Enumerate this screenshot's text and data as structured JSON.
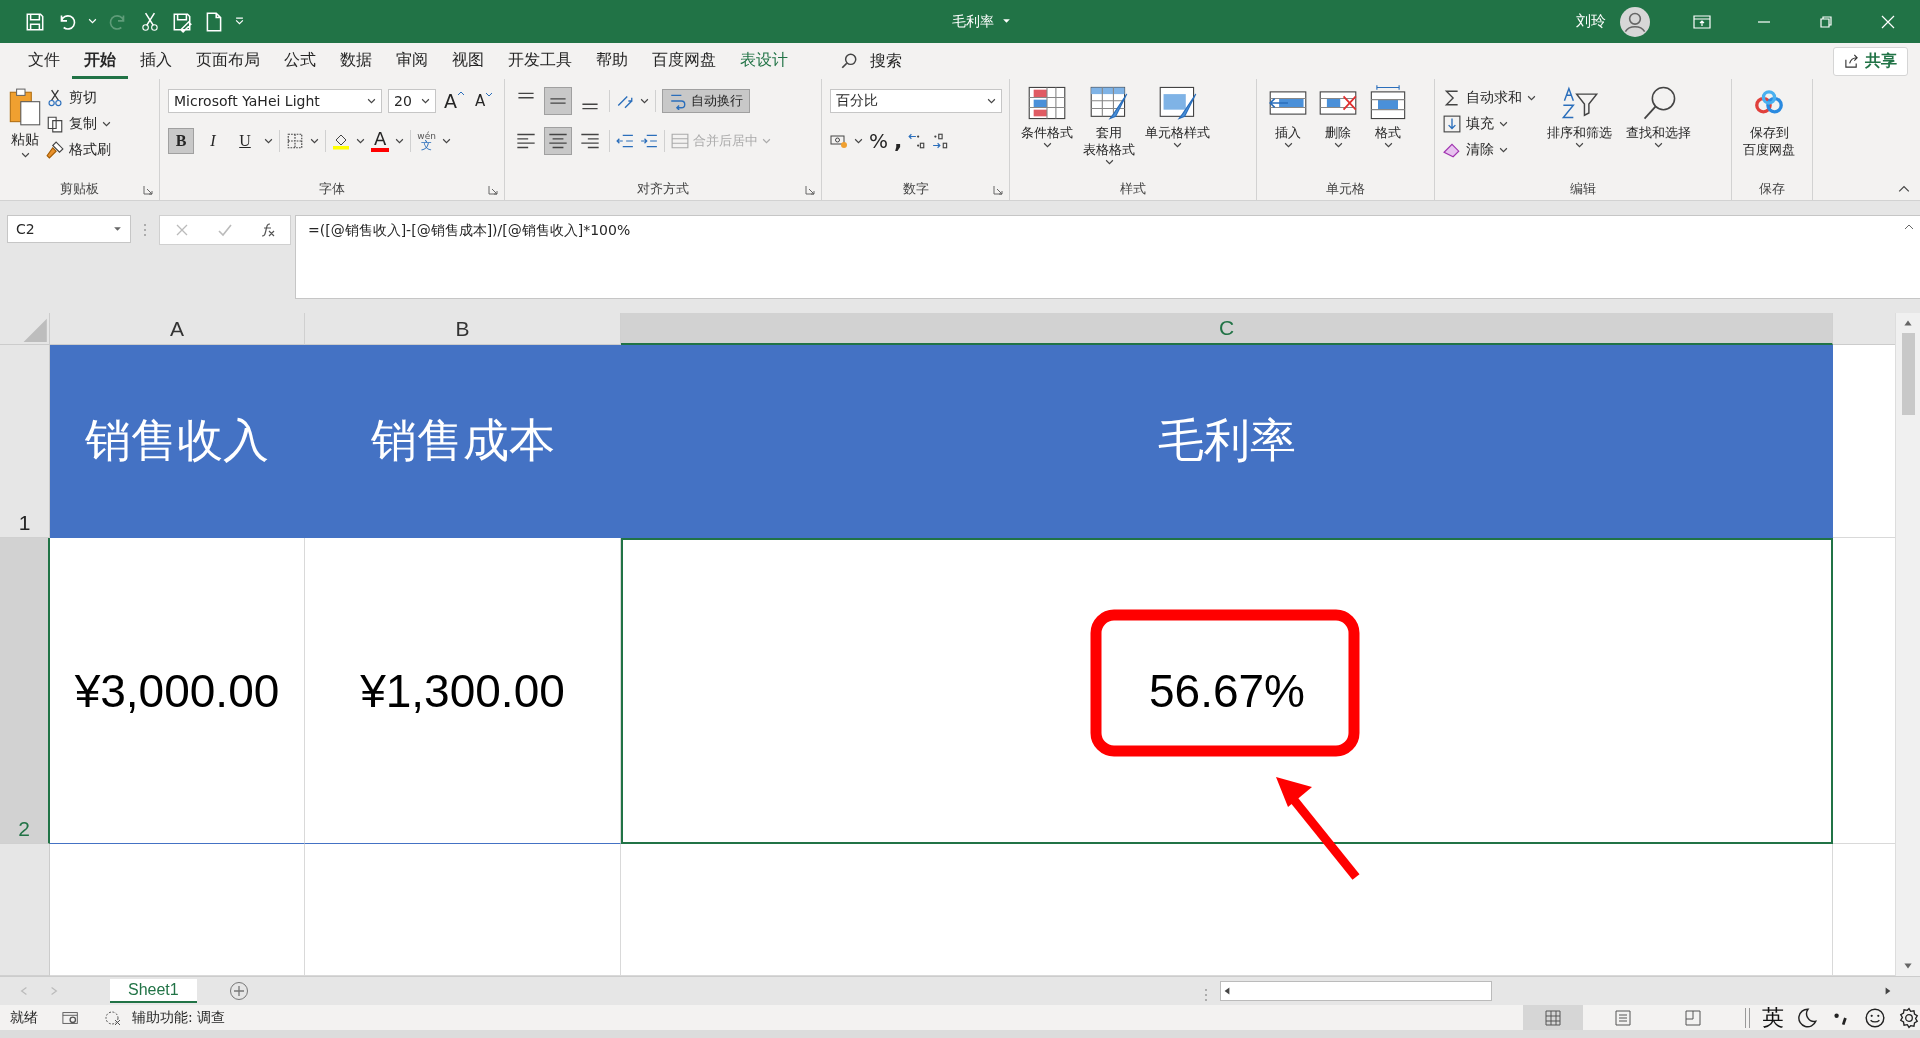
{
  "title_bar": {
    "title": "毛利率",
    "user": "刘玲"
  },
  "menu_tabs": [
    {
      "label": "文件",
      "selected": false,
      "kind": "normal"
    },
    {
      "label": "开始",
      "selected": true,
      "kind": "normal"
    },
    {
      "label": "插入",
      "selected": false,
      "kind": "normal"
    },
    {
      "label": "页面布局",
      "selected": false,
      "kind": "normal"
    },
    {
      "label": "公式",
      "selected": false,
      "kind": "normal"
    },
    {
      "label": "数据",
      "selected": false,
      "kind": "normal"
    },
    {
      "label": "审阅",
      "selected": false,
      "kind": "normal"
    },
    {
      "label": "视图",
      "selected": false,
      "kind": "normal"
    },
    {
      "label": "开发工具",
      "selected": false,
      "kind": "normal"
    },
    {
      "label": "帮助",
      "selected": false,
      "kind": "normal"
    },
    {
      "label": "百度网盘",
      "selected": false,
      "kind": "normal"
    },
    {
      "label": "表设计",
      "selected": false,
      "kind": "contextual"
    }
  ],
  "search": {
    "label": "搜索"
  },
  "share": {
    "label": "共享"
  },
  "ribbon": {
    "groups": [
      {
        "kind": "clipboard",
        "label": "剪贴板",
        "launcher": true,
        "paste": "粘贴",
        "items": [
          "剪切",
          "复制",
          "格式刷"
        ]
      },
      {
        "kind": "font",
        "label": "字体",
        "launcher": true,
        "font_name": "Microsoft YaHei Light",
        "font_size": "20",
        "grow": "A",
        "shrink": "A",
        "styles": [
          {
            "label": "B",
            "on": true
          },
          {
            "label": "I",
            "on": false
          },
          {
            "label": "U",
            "on": false
          }
        ],
        "font_color": "A",
        "phonetic_top": "wén",
        "phonetic_bottom": "文"
      },
      {
        "kind": "alignment",
        "label": "对齐方式",
        "launcher": true,
        "vertical": [
          {
            "selected": false
          },
          {
            "selected": true
          },
          {
            "selected": false
          }
        ],
        "horizontal": [
          {
            "selected": false
          },
          {
            "selected": true
          },
          {
            "selected": false
          }
        ],
        "wrap": {
          "label": "自动换行",
          "on": true
        },
        "merge": {
          "label": "合并后居中",
          "disabled": true
        }
      },
      {
        "kind": "number",
        "label": "数字",
        "launcher": true,
        "format": "百分比",
        "percent": "%",
        "comma": ","
      },
      {
        "kind": "large",
        "label": "样式",
        "items": [
          {
            "lines": [
              "条件格式"
            ],
            "caret": true
          },
          {
            "lines": [
              "套用",
              "表格格式"
            ],
            "caret": true
          },
          {
            "lines": [
              "单元格样式"
            ],
            "caret": true
          }
        ]
      },
      {
        "kind": "large",
        "label": "单元格",
        "items": [
          {
            "lines": [
              "插入"
            ],
            "caret": true
          },
          {
            "lines": [
              "删除"
            ],
            "caret": true
          },
          {
            "lines": [
              "格式"
            ],
            "caret": true
          }
        ]
      },
      {
        "kind": "editing",
        "label": "编辑",
        "small": [
          {
            "label": "自动求和"
          },
          {
            "label": "填充"
          },
          {
            "label": "清除"
          }
        ],
        "items": [
          {
            "lines": [
              "排序和筛选"
            ],
            "caret": true
          },
          {
            "lines": [
              "查找和选择"
            ],
            "caret": true
          }
        ]
      },
      {
        "kind": "large",
        "label": "保存",
        "items": [
          {
            "lines": [
              "保存到",
              "百度网盘"
            ],
            "caret": false
          }
        ]
      }
    ]
  },
  "formula_bar": {
    "name_box": "C2",
    "formula": "=([@销售收入]-[@销售成本])/[@销售收入]*100%"
  },
  "sheet": {
    "columns": [
      {
        "label": "A",
        "selected": false
      },
      {
        "label": "B",
        "selected": false
      },
      {
        "label": "C",
        "selected": true
      }
    ],
    "rows": [
      {
        "number": "1",
        "selected": false,
        "kind": "header",
        "cells": [
          {
            "text": "销售收入",
            "active": false
          },
          {
            "text": "销售成本",
            "active": false
          },
          {
            "text": "毛利率",
            "active": false
          }
        ]
      },
      {
        "number": "2",
        "selected": true,
        "kind": "data",
        "cells": [
          {
            "text": "¥3,000.00",
            "active": false
          },
          {
            "text": "¥1,300.00",
            "active": false
          },
          {
            "text": "56.67%",
            "active": true
          }
        ]
      }
    ]
  },
  "sheet_tabs": [
    {
      "label": "Sheet1",
      "selected": true
    }
  ],
  "status_bar": {
    "ready": "就绪",
    "accessibility": "辅助功能: 调查",
    "views": [
      {
        "selected": true
      },
      {
        "selected": false
      },
      {
        "selected": false
      }
    ],
    "ime": "英"
  }
}
